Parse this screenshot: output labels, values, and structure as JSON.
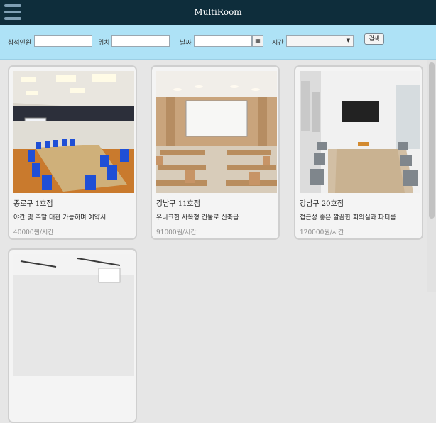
{
  "header": {
    "title": "MultiRoom",
    "menu_icon": "hamburger-menu-icon"
  },
  "search": {
    "people_label": "참석인원",
    "location_label": "위치",
    "date_label": "날짜",
    "time_label": "시간",
    "people_value": "",
    "location_value": "",
    "date_value": "",
    "time_value": "",
    "calendar_icon": "calendar-icon",
    "button_label": "검색"
  },
  "rooms": [
    {
      "name": "종로구 1호점",
      "desc": "야간 및 주말 대관 가능하며 예약시",
      "price": "40000원/시간"
    },
    {
      "name": "강남구 11호점",
      "desc": "유니크한 사옥형 건물로 신축급",
      "price": "91000원/시간"
    },
    {
      "name": "강남구 20호점",
      "desc": "접근성 좋은 깔끔한 회의실과 파티룸",
      "price": "120000원/시간"
    },
    {
      "name": "",
      "desc": "",
      "price": ""
    }
  ],
  "colors": {
    "header_bg": "#0e2d3b",
    "searchbar_bg": "#aee2f6",
    "page_bg": "#e6e6e6",
    "chair_blue": "#1f4fd6"
  }
}
